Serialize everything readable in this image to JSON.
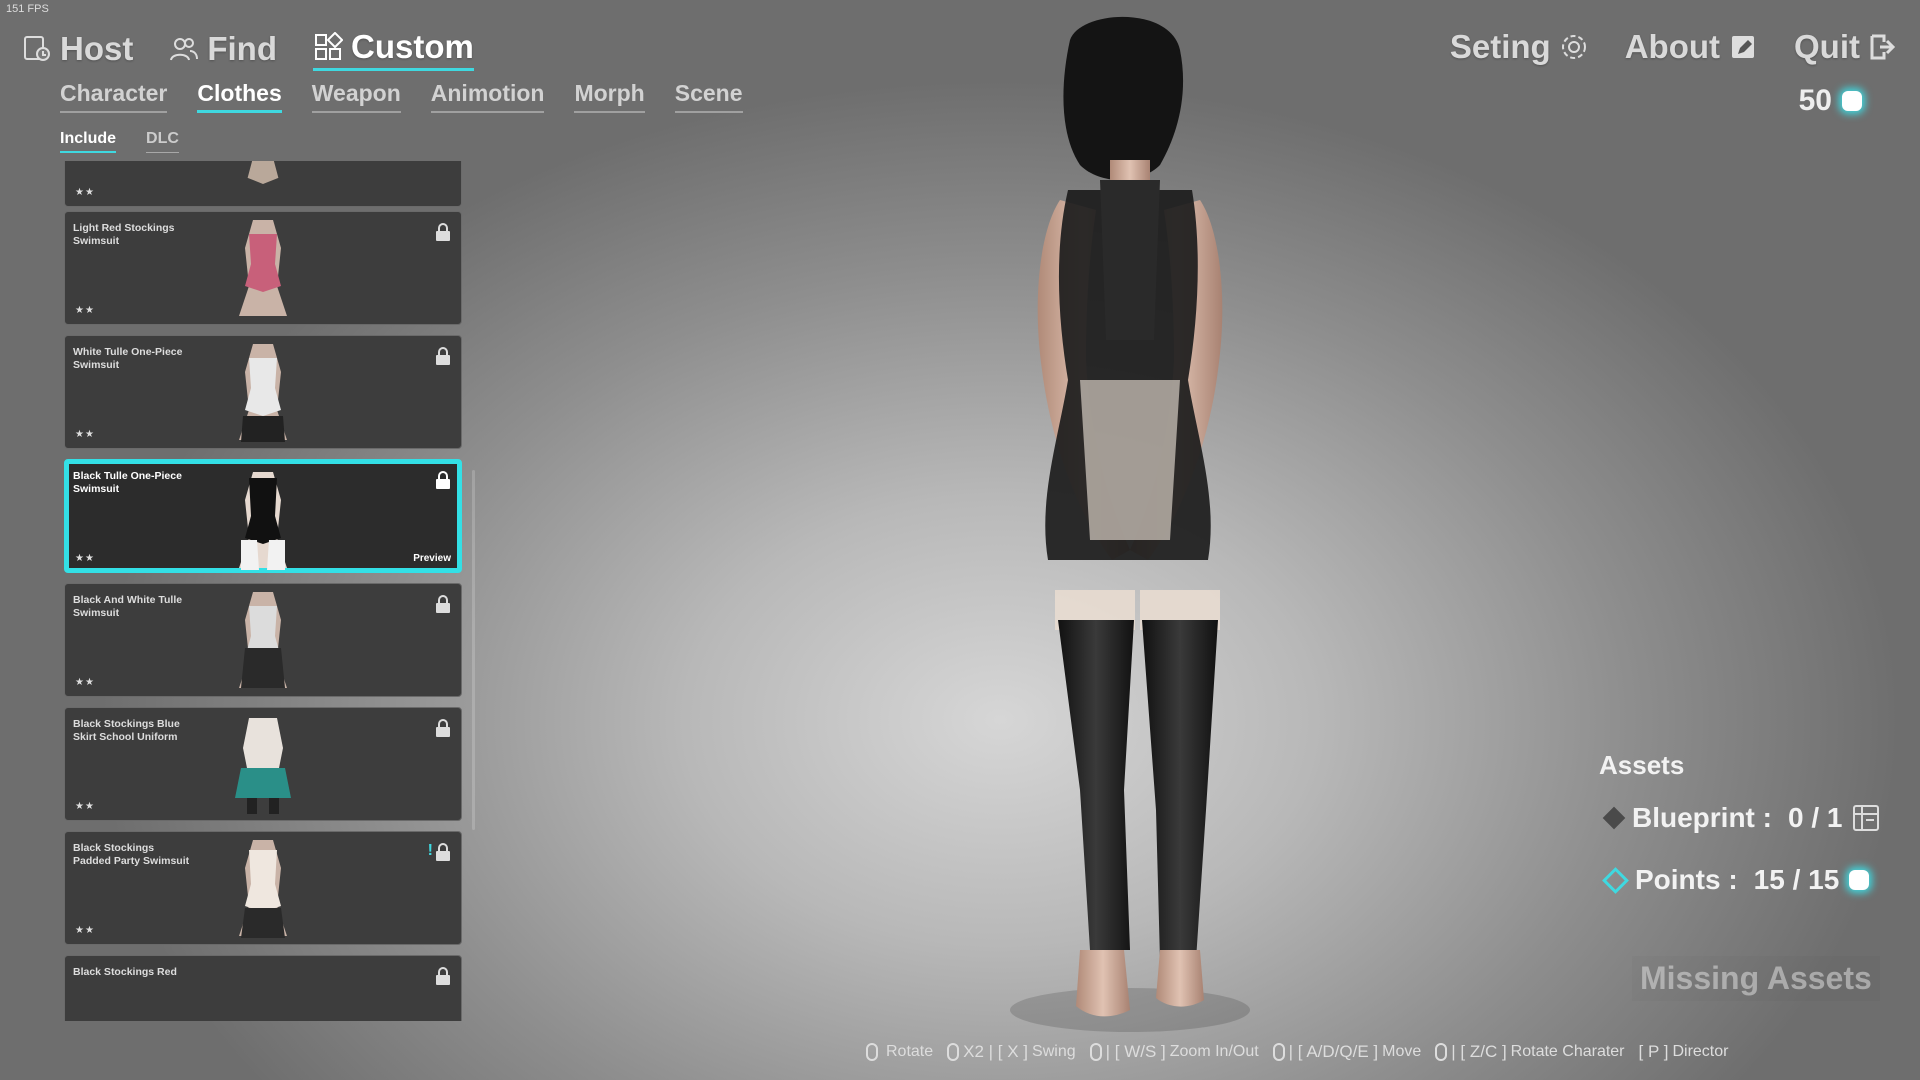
{
  "fps": "151 FPS",
  "nav": {
    "host": "Host",
    "find": "Find",
    "custom": "Custom",
    "setting": "Seting",
    "about": "About",
    "quit": "Quit"
  },
  "currency": {
    "value": "50"
  },
  "subtabs": [
    "Character",
    "Clothes",
    "Weapon",
    "Animotion",
    "Morph",
    "Scene"
  ],
  "filters": [
    "Include",
    "DLC"
  ],
  "items": [
    {
      "name": "",
      "stars": "★★"
    },
    {
      "name": "Light Red Stockings Swimsuit",
      "stars": "★★"
    },
    {
      "name": "White Tulle One-Piece Swimsuit",
      "stars": "★★"
    },
    {
      "name": "Black Tulle One-Piece Swimsuit",
      "stars": "★★",
      "preview": "Preview"
    },
    {
      "name": "Black And White Tulle Swimsuit",
      "stars": "★★"
    },
    {
      "name": "Black Stockings Blue Skirt School Uniform",
      "stars": "★★"
    },
    {
      "name": "Black Stockings Padded Party Swimsuit",
      "stars": "★★",
      "badge": "!"
    },
    {
      "name": "Black Stockings Red",
      "stars": ""
    }
  ],
  "assets": {
    "title": "Assets",
    "blueprint_label": "Blueprint :",
    "blueprint_value": "0 / 1",
    "points_label": "Points :",
    "points_value": "15 / 15",
    "missing": "Missing Assets"
  },
  "hints": [
    {
      "key": "",
      "action": "Rotate"
    },
    {
      "key": "X2 | [ X ]",
      "action": "Swing"
    },
    {
      "key": "| [ W/S ]",
      "action": "Zoom In/Out"
    },
    {
      "key": "| [ A/D/Q/E ]",
      "action": "Move"
    },
    {
      "key": "| [ Z/C ]",
      "action": "Rotate Charater"
    },
    {
      "key": "[ P ]",
      "action": "Director"
    }
  ]
}
